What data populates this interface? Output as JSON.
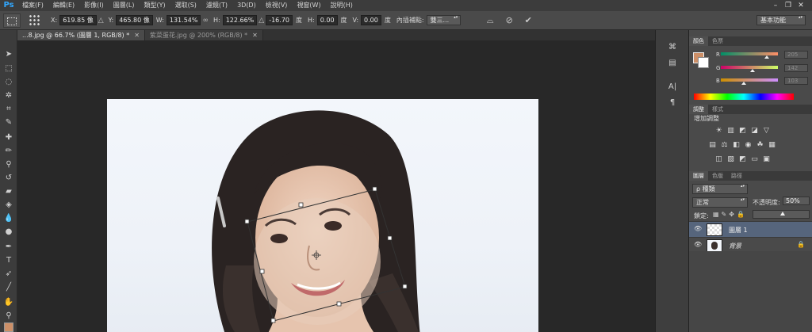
{
  "app": {
    "logo": "Ps"
  },
  "menu": [
    "檔案(F)",
    "編輯(E)",
    "影像(I)",
    "圖層(L)",
    "類型(Y)",
    "選取(S)",
    "濾鏡(T)",
    "3D(D)",
    "檢視(V)",
    "視窗(W)",
    "說明(H)"
  ],
  "window_controls": {
    "minimize": "–",
    "restore": "❐",
    "close": "✕"
  },
  "options": {
    "x_label": "X:",
    "x_value": "619.85 像",
    "y_label": "Y:",
    "y_value": "465.80 像",
    "w_label": "W:",
    "w_value": "131.54%",
    "h_label": "H:",
    "h_value": "122.66%",
    "rotate_value": "-16.70",
    "rotate_unit": "度",
    "hskew_label": "H:",
    "hskew_value": "0.00",
    "hskew_unit": "度",
    "vskew_label": "V:",
    "vskew_value": "0.00",
    "vskew_unit": "度",
    "interp_label": "內插補點:",
    "interp_value": "雙三...",
    "workspace": "基本功能"
  },
  "tabs": [
    {
      "label": "...8.jpg @ 66.7% (圖層 1, RGB/8) *",
      "close": "✕",
      "active": true
    },
    {
      "label": "紫菜蛋花.jpg @ 200% (RGB/8) *",
      "close": "✕",
      "active": false
    }
  ],
  "color_panel": {
    "tabs": [
      "顏色",
      "色票"
    ],
    "foreground": "#cd8f67",
    "background": "#ffffff",
    "channels": [
      {
        "label": "R",
        "value": "205",
        "gradient": "linear-gradient(90deg,#008f67,#ff8f67)",
        "level": 0.8
      },
      {
        "label": "G",
        "value": "142",
        "gradient": "linear-gradient(90deg,#cd0067,#cdff67)",
        "level": 0.56
      },
      {
        "label": "B",
        "value": "103",
        "gradient": "linear-gradient(90deg,#cd8f00,#cd8fff)",
        "level": 0.4
      }
    ]
  },
  "adjust_panel": {
    "tabs": [
      "調整",
      "樣式"
    ],
    "title": "增加調整"
  },
  "layers_panel": {
    "tabs": [
      "圖層",
      "色版",
      "路徑"
    ],
    "search": "ρ 種類",
    "blend_mode": "正常",
    "opacity_label": "不透明度:",
    "opacity_value": "50%",
    "lock_label": "鎖定:",
    "layers": [
      {
        "name": "圖層 1",
        "selected": true
      },
      {
        "name": "背景",
        "selected": false
      }
    ]
  }
}
